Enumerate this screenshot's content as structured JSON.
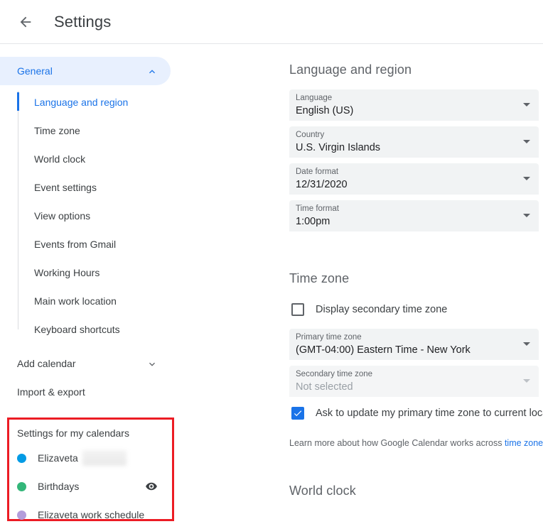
{
  "header": {
    "back_icon": "arrow-left-icon",
    "title": "Settings"
  },
  "sidebar": {
    "general": {
      "label": "General",
      "chevron_icon": "chevron-up-icon"
    },
    "subitems": [
      {
        "label": "Language and region",
        "active": true
      },
      {
        "label": "Time zone",
        "active": false
      },
      {
        "label": "World clock",
        "active": false
      },
      {
        "label": "Event settings",
        "active": false
      },
      {
        "label": "View options",
        "active": false
      },
      {
        "label": "Events from Gmail",
        "active": false
      },
      {
        "label": "Working Hours",
        "active": false
      },
      {
        "label": "Main work location",
        "active": false
      },
      {
        "label": "Keyboard shortcuts",
        "active": false
      }
    ],
    "add_calendar": {
      "label": "Add calendar",
      "chevron_icon": "chevron-down-icon"
    },
    "import_export": {
      "label": "Import & export"
    },
    "calendars": {
      "title": "Settings for my calendars",
      "items": [
        {
          "name": "Elizaveta",
          "color": "#039be5",
          "redacted": true,
          "eye_icon": false
        },
        {
          "name": "Birthdays",
          "color": "#33b679",
          "redacted": false,
          "eye_icon": true
        },
        {
          "name": "Elizaveta work schedule",
          "color": "#b39ddb",
          "redacted": false,
          "eye_icon": false
        }
      ]
    }
  },
  "main": {
    "language_region": {
      "title": "Language and region",
      "fields": [
        {
          "label": "Language",
          "value": "English (US)",
          "disabled": false
        },
        {
          "label": "Country",
          "value": "U.S. Virgin Islands",
          "disabled": false
        },
        {
          "label": "Date format",
          "value": "12/31/2020",
          "disabled": false
        },
        {
          "label": "Time format",
          "value": "1:00pm",
          "disabled": false
        }
      ]
    },
    "time_zone": {
      "title": "Time zone",
      "display_secondary": {
        "label": "Display secondary time zone",
        "checked": false
      },
      "fields": [
        {
          "label": "Primary time zone",
          "value": "(GMT-04:00) Eastern Time - New York",
          "disabled": false
        },
        {
          "label": "Secondary time zone",
          "value": "Not selected",
          "disabled": true
        }
      ],
      "ask_update": {
        "label": "Ask to update my primary time zone to current location",
        "checked": true
      },
      "help_prefix": "Learn more about how Google Calendar works across ",
      "help_link": "time zones"
    },
    "world_clock": {
      "title": "World clock"
    }
  },
  "colors": {
    "accent": "#1a73e8",
    "accent_bg": "#e8f0fe",
    "field_bg": "#f1f3f4",
    "annotation": "#ec1c24"
  }
}
